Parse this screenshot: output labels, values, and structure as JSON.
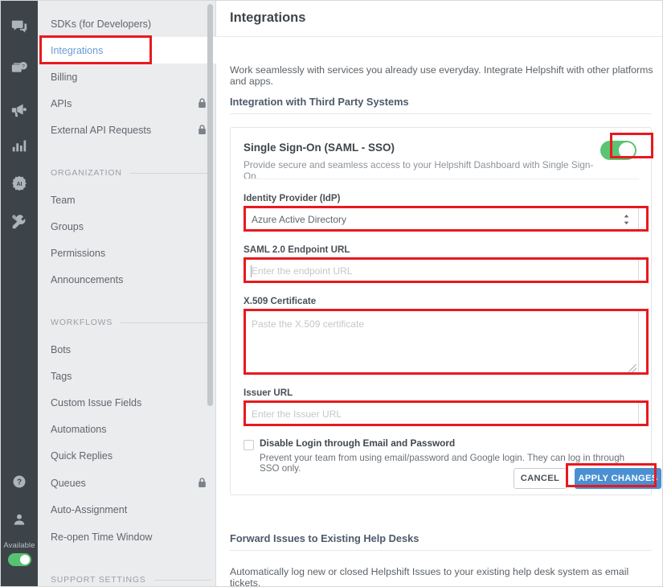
{
  "rail": {
    "icons": [
      {
        "name": "chat-icon",
        "label": "Chats"
      },
      {
        "name": "faq-icon",
        "label": "FAQs"
      },
      {
        "name": "megaphone-icon",
        "label": "Campaigns"
      },
      {
        "name": "analytics-icon",
        "label": "Analytics"
      },
      {
        "name": "ai-icon",
        "label": "AI"
      },
      {
        "name": "tools-icon",
        "label": "Settings"
      }
    ],
    "help_icon": "help-icon",
    "profile_icon": "profile-icon",
    "availability_label": "Available",
    "availability_on": true,
    "toggle_color": "#57c271"
  },
  "sidebar": {
    "items": [
      {
        "label": "SDKs (for Developers)",
        "locked": false,
        "active": false
      },
      {
        "label": "Integrations",
        "locked": false,
        "active": true
      },
      {
        "label": "Billing",
        "locked": false,
        "active": false
      },
      {
        "label": "APIs",
        "locked": true,
        "active": false
      },
      {
        "label": "External API Requests",
        "locked": true,
        "active": false
      }
    ],
    "sections": [
      {
        "title": "ORGANIZATION",
        "items": [
          {
            "label": "Team",
            "locked": false
          },
          {
            "label": "Groups",
            "locked": false
          },
          {
            "label": "Permissions",
            "locked": false
          },
          {
            "label": "Announcements",
            "locked": false
          }
        ]
      },
      {
        "title": "WORKFLOWS",
        "items": [
          {
            "label": "Bots",
            "locked": false
          },
          {
            "label": "Tags",
            "locked": false
          },
          {
            "label": "Custom Issue Fields",
            "locked": false
          },
          {
            "label": "Automations",
            "locked": false
          },
          {
            "label": "Quick Replies",
            "locked": false
          },
          {
            "label": "Queues",
            "locked": true
          },
          {
            "label": "Auto-Assignment",
            "locked": false
          },
          {
            "label": "Re-open Time Window",
            "locked": false
          }
        ]
      },
      {
        "title": "SUPPORT SETTINGS",
        "items": []
      }
    ],
    "active_item_color": "#6b9bd2"
  },
  "main": {
    "page_title": "Integrations",
    "intro_text": "Work seamlessly with services you already use everyday. Integrate Helpshift with other platforms and apps.",
    "third_party_heading": "Integration with Third Party Systems",
    "sso": {
      "title": "Single Sign-On (SAML - SSO)",
      "subtitle": "Provide secure and seamless access to your Helpshift Dashboard with Single Sign-On.",
      "enabled": true,
      "toggle_color": "#5cc374",
      "idp_label": "Identity Provider (IdP)",
      "idp_value": "Azure Active Directory",
      "idp_options": [
        "Azure Active Directory"
      ],
      "endpoint_label": "SAML 2.0 Endpoint URL",
      "endpoint_value": "",
      "endpoint_placeholder": "Enter the endpoint URL",
      "cert_label": "X.509 Certificate",
      "cert_value": "",
      "cert_placeholder": "Paste the X.509 certificate",
      "issuer_label": "Issuer URL",
      "issuer_value": "",
      "issuer_placeholder": "Enter the Issuer URL",
      "disable_checkbox_label": "Disable Login through Email and Password",
      "disable_checkbox_desc": "Prevent your team from using email/password and Google login. They can log in through SSO only.",
      "disable_checkbox_checked": false,
      "cancel_label": "CANCEL",
      "apply_label": "APPLY CHANGES",
      "apply_color": "#4a90d2"
    },
    "forward": {
      "heading": "Forward Issues to Existing Help Desks",
      "description": "Automatically log new or closed Helpshift Issues to your existing help desk system as email tickets."
    }
  },
  "annotations": {
    "highlight_color": "#e8191f",
    "boxes": [
      "sidebar-integrations",
      "sso-toggle",
      "idp-select",
      "endpoint-input",
      "cert-textarea",
      "issuer-input",
      "apply-button"
    ]
  }
}
